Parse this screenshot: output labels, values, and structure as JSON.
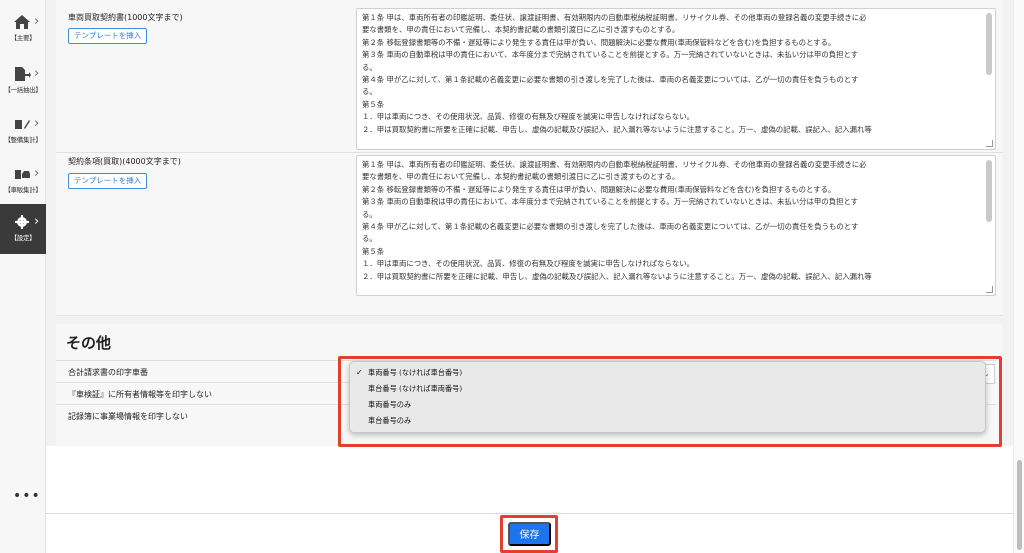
{
  "sidebar": {
    "items": [
      {
        "label": "【主要】",
        "icon": "home-icon"
      },
      {
        "label": "【一括抽出】",
        "icon": "file-export-icon"
      },
      {
        "label": "【整備集計】",
        "icon": "maintenance-list-icon"
      },
      {
        "label": "【車販集計】",
        "icon": "car-sales-icon"
      },
      {
        "label": "【設定】",
        "icon": "gear-icon"
      }
    ],
    "more": "•••"
  },
  "contracts": [
    {
      "label": "車両買取契約書(1000文字まで)",
      "template_button": "テンプレートを挿入",
      "lines": [
        "第１条 甲は、車両所有者の印鑑証明、委任状、譲渡証明書、有効期限内の自動車税納税証明書、リサイクル券、その他車両の登録名義の変更手続きに必",
        "要な書類を、甲の責任において完備し、本契約書記載の書類引渡日に乙に引き渡すものとする。",
        "第２条 移転登録書類等の不備・遅延等により発生する責任は甲が負い、問題解決に必要な費用(車両保管料などを含む)を負担するものとする。",
        "第３条 車両の自動車税は甲の責任において、本年度分まで完納されていることを前提とする。万一完納されていないときは、未払い分は甲の負担とす",
        "る。",
        "第４条 甲が乙に対して、第１条記載の名義変更に必要な書類の引き渡しを完了した後は、車両の名義変更については、乙が一切の責任を負うものとす",
        "る。",
        "第５条",
        "１．甲は車両につき、その使用状況、品質、修復の有無及び程度を誠実に申告しなければならない。",
        "２．甲は買取契約書に所要を正確に記載、申告し、虚偽の記載及び誤記入、記入漏れ等ないように注意すること。万一、虚偽の記載、誤記入、記入漏れ等"
      ]
    },
    {
      "label": "契約条項(買取)(4000文字まで)",
      "template_button": "テンプレートを挿入",
      "lines": [
        "第１条 甲は、車両所有者の印鑑証明、委任状、譲渡証明書、有効期限内の自動車税納税証明書、リサイクル券、その他車両の登録名義の変更手続きに必",
        "要な書類を、甲の責任において完備し、本契約書記載の書類引渡日に乙に引き渡すものとする。",
        "第２条 移転登録書類等の不備・遅延等により発生する責任は甲が負い、問題解決に必要な費用(車両保管料などを含む)を負担するものとする。",
        "第３条 車両の自動車税は甲の責任において、本年度分まで完納されていることを前提とする。万一完納されていないときは、未払い分は甲の負担とす",
        "る。",
        "第４条 甲が乙に対して、第１条記載の名義変更に必要な書類の引き渡しを完了した後は、車両の名義変更については、乙が一切の責任を負うものとす",
        "る。",
        "第５条",
        "１．甲は車両につき、その使用状況、品質、修復の有無及び程度を誠実に申告しなければならない。",
        "２．甲は買取契約書に所要を正確に記載、申告し、虚偽の記載及び誤記入、記入漏れ等ないように注意すること。万一、虚偽の記載、誤記入、記入漏れ等"
      ]
    }
  ],
  "other": {
    "title": "その他",
    "rows": [
      {
        "label": "合計請求書の印字車番"
      },
      {
        "label": "『車検証』に所有者情報等を印字しない"
      },
      {
        "label": "記録簿に事業場情報を印字しない"
      }
    ],
    "dropdown": {
      "selected": "車両番号 (なければ車台番号)",
      "options": [
        "車両番号 (なければ車台番号)",
        "車台番号 (なければ車両番号)",
        "車両番号のみ",
        "車台番号のみ"
      ],
      "check": "✓"
    }
  },
  "footer": {
    "save_label": "保存"
  },
  "colors": {
    "primary": "#1e74ef",
    "highlight": "#e2402c",
    "sidebar_active": "#3a3a3a"
  }
}
